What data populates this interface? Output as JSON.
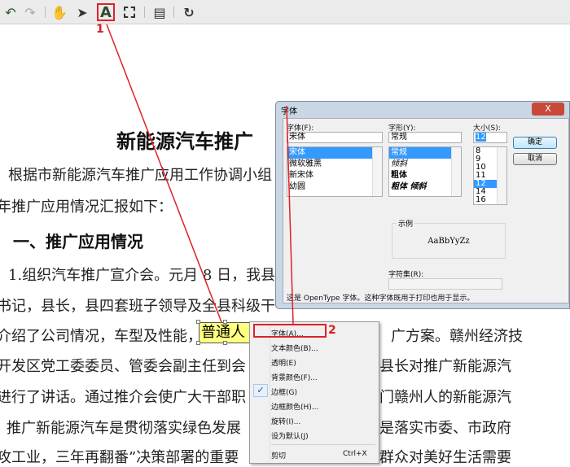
{
  "toolbar": {
    "items": [
      "undo-icon",
      "redo-icon",
      "hand-icon",
      "select-arrow-icon",
      "text-tool-icon",
      "marquee-select-icon",
      "document-properties-icon",
      "refresh-icon"
    ],
    "text_tool_glyph": "A"
  },
  "document": {
    "title": "新能源汽车推广",
    "lines": [
      {
        "left": "根据市新能源汽车推广应用工作协调小组",
        "right": ""
      },
      {
        "left": "年推广应用情况汇报如下：",
        "right": ""
      },
      {
        "left": "1.组织汽车推广宣介会。元月 8 日，我县",
        "right": ""
      },
      {
        "left": "书记，县长，县四套班子领导及全县科级干",
        "right": ""
      },
      {
        "left": "介绍了公司情况，车型及性能，",
        "right": "广方案。赣州经济技"
      },
      {
        "left": "开发区党工委委员、管委会副主任到会",
        "right": "县长对推广新能源汽"
      },
      {
        "left": "进行了讲话。通过推介会使广大干部职",
        "right": "门赣州人的新能源汽"
      },
      {
        "left": "推广新能源汽车是贯彻落实绿色发展",
        "right": "是落实市委、市政府"
      },
      {
        "left": "攻工业，三年再翻番”决策部署的重要",
        "right": "群众对美好生活需要"
      }
    ],
    "heading": "一、推广应用情况",
    "selected_text": "普通人"
  },
  "font_dialog": {
    "title": "字体",
    "close": "X",
    "font_label": "字体(F):",
    "font_value": "宋体",
    "fonts": [
      "宋体",
      "微软雅黑",
      "新宋体",
      "幼圆"
    ],
    "style_label": "字形(Y):",
    "style_value": "常规",
    "styles": [
      "常规",
      "倾斜",
      "粗体",
      "粗体 倾斜"
    ],
    "size_label": "大小(S):",
    "size_value": "12",
    "sizes": [
      "8",
      "9",
      "10",
      "11",
      "12",
      "14",
      "16"
    ],
    "ok": "确定",
    "cancel": "取消",
    "sample_label": "示例",
    "sample_text": "AaBbYyZz",
    "charset_label": "字符集(R):",
    "charset_value": "",
    "note": "这是 OpenType 字体。这种字体既用于打印也用于显示。"
  },
  "context_menu": {
    "items": [
      {
        "label": "字体(A)...",
        "checked": false
      },
      {
        "label": "文本颜色(B)...",
        "checked": false
      },
      {
        "label": "透明(E)",
        "checked": false
      },
      {
        "label": "背景颜色(F)...",
        "checked": false
      },
      {
        "label": "边框(G)",
        "checked": true
      },
      {
        "label": "边框颜色(H)...",
        "checked": false
      },
      {
        "label": "旋转(I)...",
        "checked": false
      },
      {
        "label": "设为默认(J)",
        "checked": false
      }
    ],
    "cut": {
      "label": "剪切",
      "shortcut": "Ctrl+X"
    },
    "check_glyph": "✓"
  },
  "annotations": {
    "step1": "1",
    "step2": "2",
    "color": "#e0202a"
  }
}
